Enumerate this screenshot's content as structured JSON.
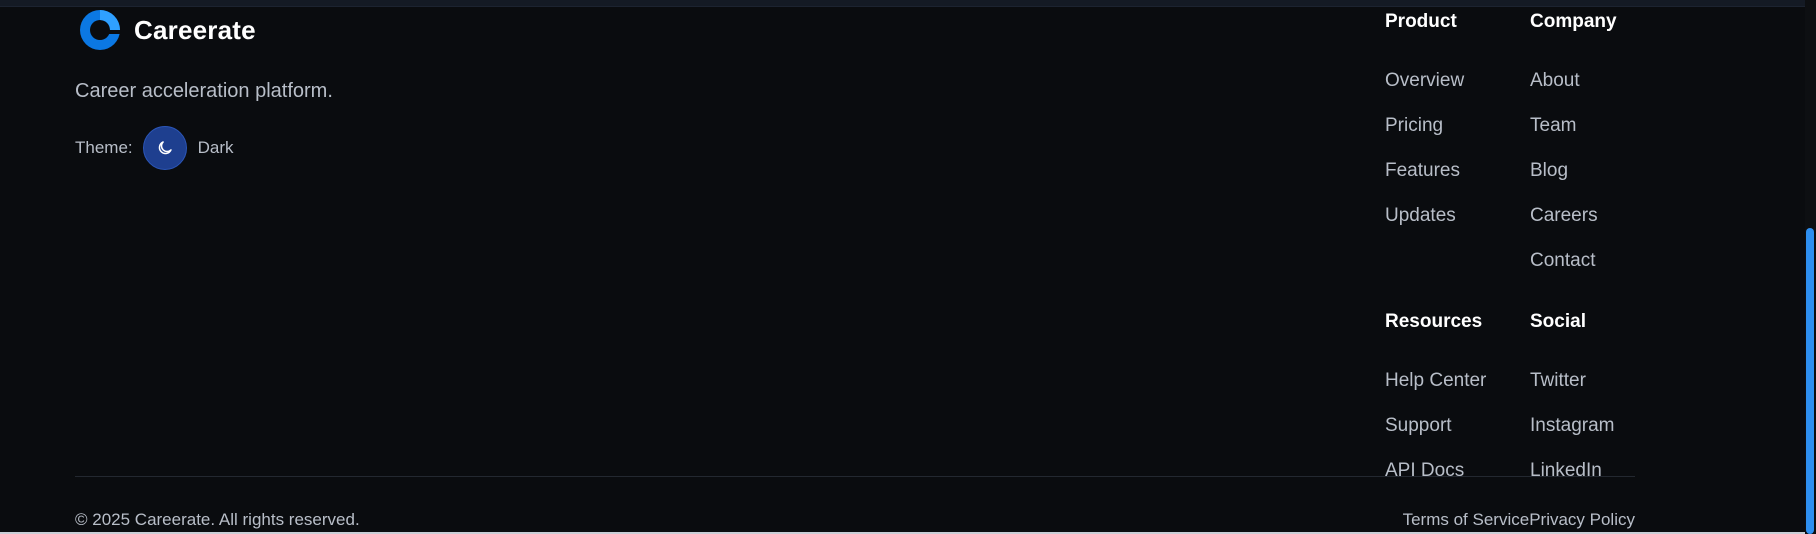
{
  "brand": {
    "name": "Careerate",
    "tagline": "Career acceleration platform.",
    "logo_colors": {
      "primary": "#0b78e3",
      "secondary": "#2fa0ff"
    }
  },
  "theme": {
    "label": "Theme:",
    "value": "Dark",
    "toggle_icon": "moon-icon",
    "toggle_color": "#1e3f8f"
  },
  "footer": {
    "product": {
      "heading": "Product",
      "links": [
        "Overview",
        "Pricing",
        "Features",
        "Updates"
      ]
    },
    "company": {
      "heading": "Company",
      "links": [
        "About",
        "Team",
        "Blog",
        "Careers",
        "Contact"
      ]
    },
    "resources": {
      "heading": "Resources",
      "links": [
        "Help Center",
        "Support",
        "API Docs"
      ]
    },
    "social": {
      "heading": "Social",
      "links": [
        "Twitter",
        "Instagram",
        "LinkedIn"
      ]
    },
    "copyright": "© 2025 Careerate. All rights reserved.",
    "legal": {
      "terms": "Terms of Service",
      "privacy": "Privacy Policy"
    }
  },
  "colors": {
    "background": "#0a0c0f",
    "text_muted": "#b8bec8",
    "heading": "#ffffff",
    "scrollbar_thumb": "#2e8ff0"
  }
}
